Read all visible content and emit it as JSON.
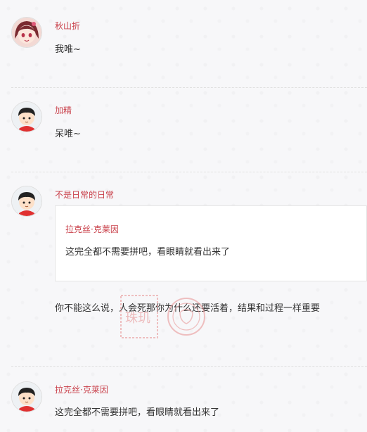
{
  "comments": [
    {
      "author": "秋山折",
      "text": "我唯~",
      "avatar_icon": "anime-girl-avatar-icon"
    },
    {
      "author": "加精",
      "text": "呆唯~",
      "avatar_icon": "cartoon-boy-avatar-icon"
    },
    {
      "author": "不是日常的日常",
      "quote": {
        "author": "拉克丝·克莱因",
        "text": "这完全都不需要拼吧，看眼睛就看出来了"
      },
      "text": "你不能这么说，人会死那你为什么还要活着，结果和过程一样重要",
      "avatar_icon": "cartoon-boy-avatar-icon"
    },
    {
      "author": "拉克丝·克莱因",
      "text": "这完全都不需要拼吧，看眼睛就看出来了",
      "avatar_icon": "cartoon-boy-avatar-icon"
    }
  ],
  "watermark": {
    "text": "珠玑",
    "icon": "seal-stamp-icon"
  },
  "colors": {
    "author": "#c9404a",
    "text": "#333333",
    "background": "#f7f7f9"
  }
}
